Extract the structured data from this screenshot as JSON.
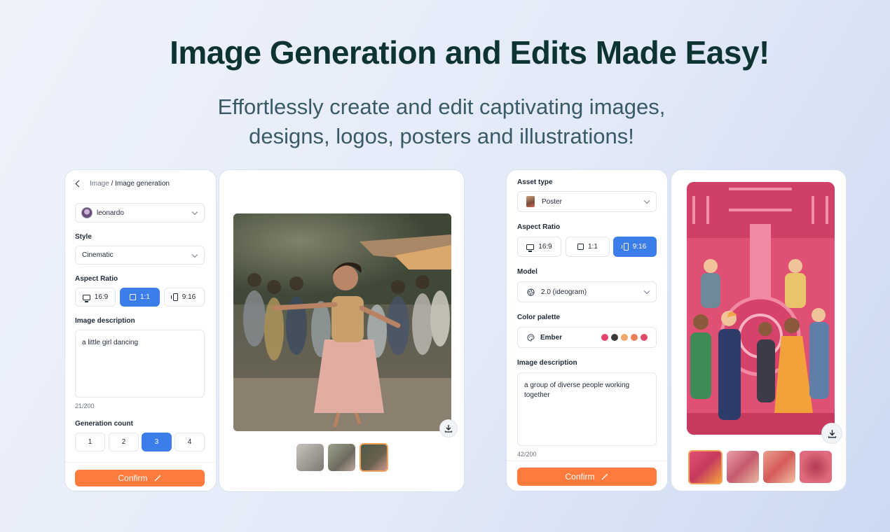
{
  "hero": {
    "title": "Image Generation and Edits Made Easy!",
    "subtitle_line1": "Effortlessly create and edit captivating images,",
    "subtitle_line2": "designs, logos, posters and illustrations!"
  },
  "left_panel": {
    "breadcrumb_parent": "Image",
    "breadcrumb_sep": " / ",
    "breadcrumb_current": "Image generation",
    "model_value": "leonardo",
    "style_label": "Style",
    "style_value": "Cinematic",
    "aspect_label": "Aspect Ratio",
    "aspect_options": [
      "16:9",
      "1:1",
      "9:16"
    ],
    "aspect_selected": "1:1",
    "description_label": "Image description",
    "description_value": "a little girl dancing",
    "description_counter": "21/200",
    "count_label": "Generation count",
    "count_options": [
      "1",
      "2",
      "3",
      "4"
    ],
    "count_selected": "3",
    "confirm_label": "Confirm"
  },
  "right_panel": {
    "asset_label": "Asset type",
    "asset_value": "Poster",
    "aspect_label": "Aspect Ratio",
    "aspect_options": [
      "16:9",
      "1:1",
      "9:16"
    ],
    "aspect_selected": "9:16",
    "model_label": "Model",
    "model_value": "2.0 (ideogram)",
    "palette_label": "Color palette",
    "palette_value": "Ember",
    "palette_colors": [
      "#e8436f",
      "#3b3b3b",
      "#f2a86a",
      "#ec7f5a",
      "#e24a6a"
    ],
    "description_label": "Image description",
    "description_value": "a group of diverse people working together",
    "description_counter": "42/200",
    "confirm_label": "Confirm"
  },
  "colors": {
    "accent_blue": "#3b7de9",
    "confirm_orange": "#ff7a3d",
    "title_dark": "#0d3333"
  }
}
